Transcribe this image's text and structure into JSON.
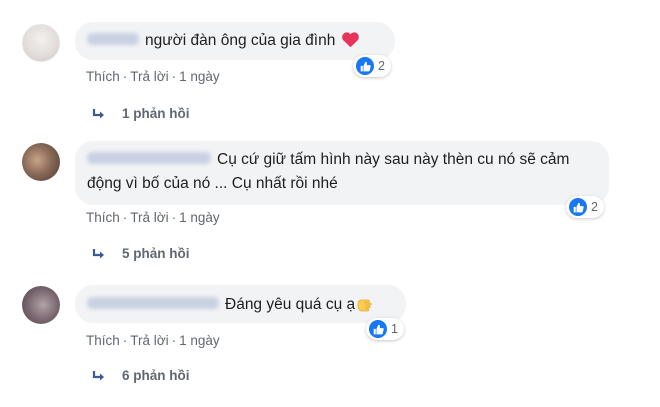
{
  "comments": [
    {
      "text": "người đàn ông của gia đình",
      "reaction_count": "2",
      "actions": {
        "like": "Thích",
        "reply": "Trả lời",
        "time": "1 ngày"
      },
      "replies_label": "1 phản hồi",
      "emoji": "red-heart"
    },
    {
      "text_line1": "Cụ cứ giữ tấm hình này sau này thèn cu nó sẽ cảm",
      "text_line2": "động vì bố của nó ... Cụ nhất rồi nhé",
      "reaction_count": "2",
      "actions": {
        "like": "Thích",
        "reply": "Trả lời",
        "time": "1 ngày"
      },
      "replies_label": "5 phản hồi"
    },
    {
      "text": "Đáng yêu quá cụ ạ",
      "reaction_count": "1",
      "actions": {
        "like": "Thích",
        "reply": "Trả lời",
        "time": "1 ngày"
      },
      "replies_label": "6 phản hồi",
      "emoji": "pointing-hand"
    }
  ],
  "colors": {
    "bubble_bg": "#f2f3f5",
    "like_blue": "#1877f2",
    "meta_gray": "#606770",
    "heart_red": "#e8345a"
  }
}
